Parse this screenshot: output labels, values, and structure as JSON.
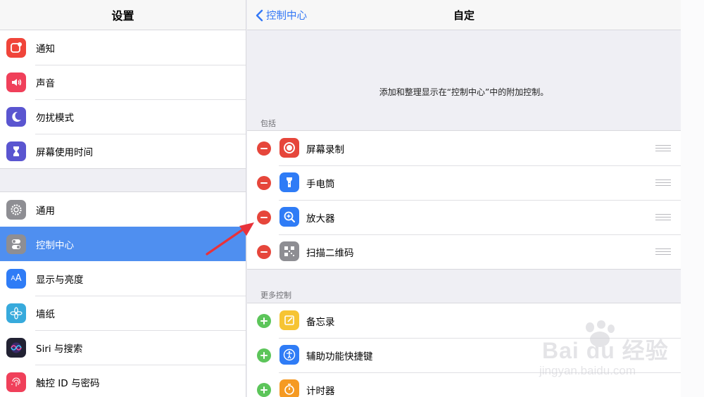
{
  "left": {
    "title": "设置",
    "group1": [
      {
        "label": "通知",
        "icon": "notifications-icon",
        "color": "#f0453a"
      },
      {
        "label": "声音",
        "icon": "sound-icon",
        "color": "#f0405a"
      },
      {
        "label": "勿扰模式",
        "icon": "moon-icon",
        "color": "#5a55d0"
      },
      {
        "label": "屏幕使用时间",
        "icon": "hourglass-icon",
        "color": "#5a55d0"
      }
    ],
    "group2": [
      {
        "label": "通用",
        "icon": "gear-icon",
        "color": "#8e8e93"
      },
      {
        "label": "控制中心",
        "icon": "toggles-icon",
        "color": "#8e8e93",
        "selected": true
      },
      {
        "label": "显示与亮度",
        "icon": "display-icon",
        "color": "#2f7cf6"
      },
      {
        "label": "墙纸",
        "icon": "flower-icon",
        "color": "#37aadc"
      },
      {
        "label": "Siri 与搜索",
        "icon": "siri-icon",
        "color": "#222233"
      },
      {
        "label": "触控 ID 与密码",
        "icon": "fingerprint-icon",
        "color": "#f0405a"
      }
    ]
  },
  "right": {
    "back_label": "控制中心",
    "title": "自定",
    "description": "添加和整理显示在“控制中心”中的附加控制。",
    "include_label": "包括",
    "more_label": "更多控制",
    "included": [
      {
        "label": "屏幕录制",
        "icon": "screen-record-icon",
        "color": "#e6463b"
      },
      {
        "label": "手电筒",
        "icon": "flashlight-icon",
        "color": "#2f7cf6"
      },
      {
        "label": "放大器",
        "icon": "magnifier-icon",
        "color": "#2f7cf6"
      },
      {
        "label": "扫描二维码",
        "icon": "qr-code-icon",
        "color": "#8e8e93"
      }
    ],
    "more": [
      {
        "label": "备忘录",
        "icon": "notes-icon",
        "color": "#f6c433"
      },
      {
        "label": "辅助功能快捷键",
        "icon": "accessibility-icon",
        "color": "#2f7cf6"
      },
      {
        "label": "计时器",
        "icon": "timer-icon",
        "color": "#f59a23"
      }
    ]
  },
  "watermark": {
    "main": "Bai du 经验",
    "sub": "jingyan.baidu.com"
  },
  "colors": {
    "accent": "#3478f6",
    "selected": "#4f8ff0",
    "remove": "#e6463b",
    "add": "#5cc55a",
    "arrow": "#e8323a"
  }
}
